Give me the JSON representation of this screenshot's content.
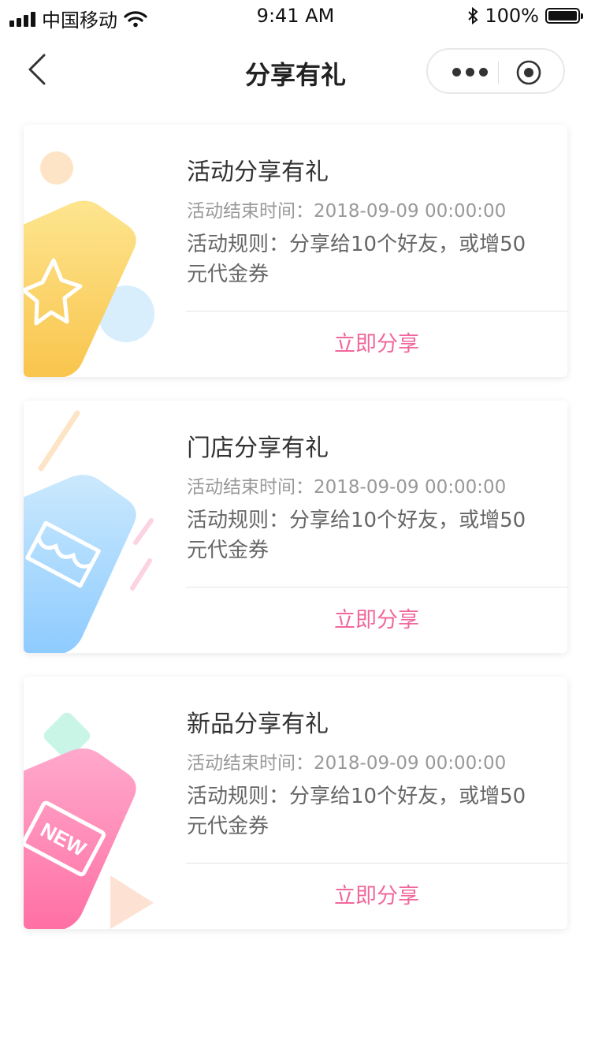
{
  "status_bar": {
    "carrier": "中国移动",
    "time": "9:41 AM",
    "battery_percent": "100%"
  },
  "nav": {
    "title": "分享有礼",
    "back_icon": "chevron-left-icon",
    "more_icon": "more-dots-icon",
    "close_icon": "target-circle-icon"
  },
  "activities": [
    {
      "name": "活动分享有礼",
      "end_time": "活动结束时间：2018-09-09 00:00:00",
      "rules": "活动规则：分享给10个好友，或增50元代金券",
      "share_label": "立即分享",
      "illustration_icon": "star-icon"
    },
    {
      "name": "门店分享有礼",
      "end_time": "活动结束时间：2018-09-09 00:00:00",
      "rules": "活动规则：分享给10个好友，或增50元代金券",
      "share_label": "立即分享",
      "illustration_icon": "store-icon"
    },
    {
      "name": "新品分享有礼",
      "end_time": "活动结束时间：2018-09-09 00:00:00",
      "rules": "活动规则：分享给10个好友，或增50元代金券",
      "share_label": "立即分享",
      "illustration_icon": "new-badge-icon",
      "badge_text": "NEW"
    }
  ],
  "colors": {
    "accent": "#f0679c",
    "yellow": "#f9c94c",
    "blue": "#8ecbff",
    "pink": "#ff74a6"
  }
}
